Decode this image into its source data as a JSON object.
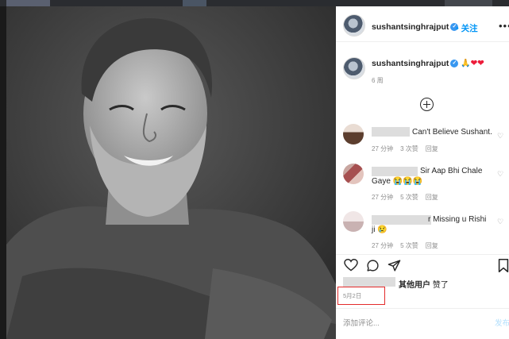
{
  "post": {
    "author": "sushantsinghrajput",
    "follow_label": "• 关注",
    "more_label": "•••",
    "caption_emojis": "🙏❤❤",
    "caption_time": "6 周",
    "add_icon": "plus-circle-icon"
  },
  "comments": [
    {
      "text": "Can't Believe Sushant.",
      "time": "27 分钟",
      "likes": "3 次赞",
      "reply": "回复"
    },
    {
      "text_line1": "Sir Aap Bhi Chale",
      "text_line2": "Gaye 😭😭😭",
      "time": "27 分钟",
      "likes": "5 次赞",
      "reply": "回复"
    },
    {
      "text_line1": "r Missing u Rishi",
      "text_line2": "ji 😢",
      "time": "27 分钟",
      "likes": "5 次赞",
      "reply": "回复"
    }
  ],
  "actions": {
    "likes_suffix": "其他用户",
    "likes_verb": "赞了",
    "date": "5月2日",
    "comment_placeholder": "添加评论...",
    "post_label": "发布"
  },
  "colors": {
    "accent": "#0095f6",
    "highlight_box": "#e32b2b",
    "heart": "#ed1c3a"
  }
}
